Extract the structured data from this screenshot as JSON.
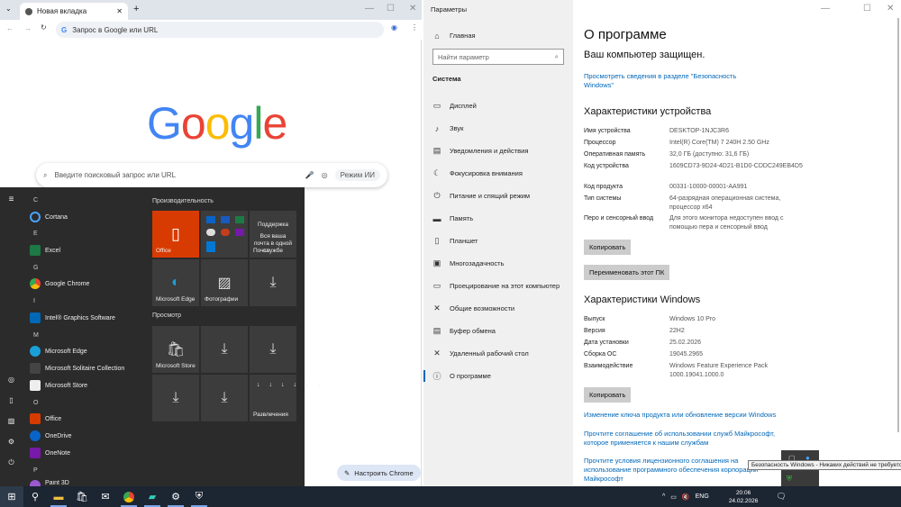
{
  "chrome": {
    "tab_title": "Новая вкладка",
    "omnibox_placeholder": "Запрос в Google или URL",
    "logo": "Google",
    "search_placeholder": "Введите поисковый запрос или URL",
    "ai_mode": "Режим ИИ",
    "restore": "Настроить Chrome"
  },
  "start": {
    "letters": [
      "C",
      "E",
      "G",
      "I",
      "M",
      "O",
      "P"
    ],
    "apps": [
      "Cortana",
      "Excel",
      "Google Chrome",
      "Intel® Graphics Software",
      "Microsoft Edge",
      "Microsoft Solitaire Collection",
      "Microsoft Store",
      "Office",
      "OneDrive",
      "OneNote",
      "Paint 3D"
    ],
    "groups": [
      "Производительность",
      "Просмотр"
    ],
    "tiles": {
      "office": "Office",
      "mail_title": "Поддержка",
      "mail_body": "Вся ваша почта в одной службе",
      "mail_label": "Почта",
      "edge": "Microsoft Edge",
      "photos": "Фотографии",
      "store": "Microsoft Store",
      "entertainment": "Развлечения"
    }
  },
  "settings": {
    "window_title": "Параметры",
    "home": "Главная",
    "search_placeholder": "Найти параметр",
    "section": "Система",
    "nav": [
      "Дисплей",
      "Звук",
      "Уведомления и действия",
      "Фокусировка внимания",
      "Питание и спящий режим",
      "Память",
      "Планшет",
      "Многозадачность",
      "Проецирование на этот компьютер",
      "Общие возможности",
      "Буфер обмена",
      "Удаленный рабочий стол",
      "О программе"
    ],
    "page_title": "О программе",
    "protected": "Ваш компьютер защищен.",
    "security_link": "Просмотреть сведения в разделе \"Безопасность Windows\"",
    "device_heading": "Характеристики устройства",
    "device": [
      {
        "k": "Имя устройства",
        "v": "DESKTOP-1NJC3R6"
      },
      {
        "k": "Процессор",
        "v": "Intel(R) Core(TM) 7 240H   2.50 GHz"
      },
      {
        "k": "Оперативная память",
        "v": "32,0 ГБ (доступно: 31,6 ГБ)"
      },
      {
        "k": "Код устройства",
        "v": "1609CD73-9D24-4D21-B1D0-CDDC249EB4D5"
      },
      {
        "k": "Код продукта",
        "v": "00331-10000-00001-AA991"
      },
      {
        "k": "Тип системы",
        "v": "64-разрядная операционная система, процессор x64"
      },
      {
        "k": "Перо и сенсорный ввод",
        "v": "Для этого монитора недоступен ввод с помощью пера и сенсорный ввод"
      }
    ],
    "copy": "Копировать",
    "rename": "Переименовать этот ПК",
    "windows_heading": "Характеристики Windows",
    "windows": [
      {
        "k": "Выпуск",
        "v": "Windows 10 Pro"
      },
      {
        "k": "Версия",
        "v": "22H2"
      },
      {
        "k": "Дата установки",
        "v": "25.02.2026"
      },
      {
        "k": "Сборка ОС",
        "v": "19045.2965"
      },
      {
        "k": "Взаимодействие",
        "v": "Windows Feature Experience Pack 1000.19041.1000.0"
      }
    ],
    "links": [
      "Изменение ключа продукта или обновление версии Windows",
      "Прочтите соглашение об использовании служб Майкрософт, которое применяется к нашим службам",
      "Прочтите условия лицензионного соглашения на использование программного обеспечения корпорации Майкрософт"
    ]
  },
  "taskbar": {
    "lang": "ENG",
    "time": "20:06",
    "date": "24.02.2026",
    "tooltip": "Безопасность Windows - Никаких действий не требуется."
  }
}
